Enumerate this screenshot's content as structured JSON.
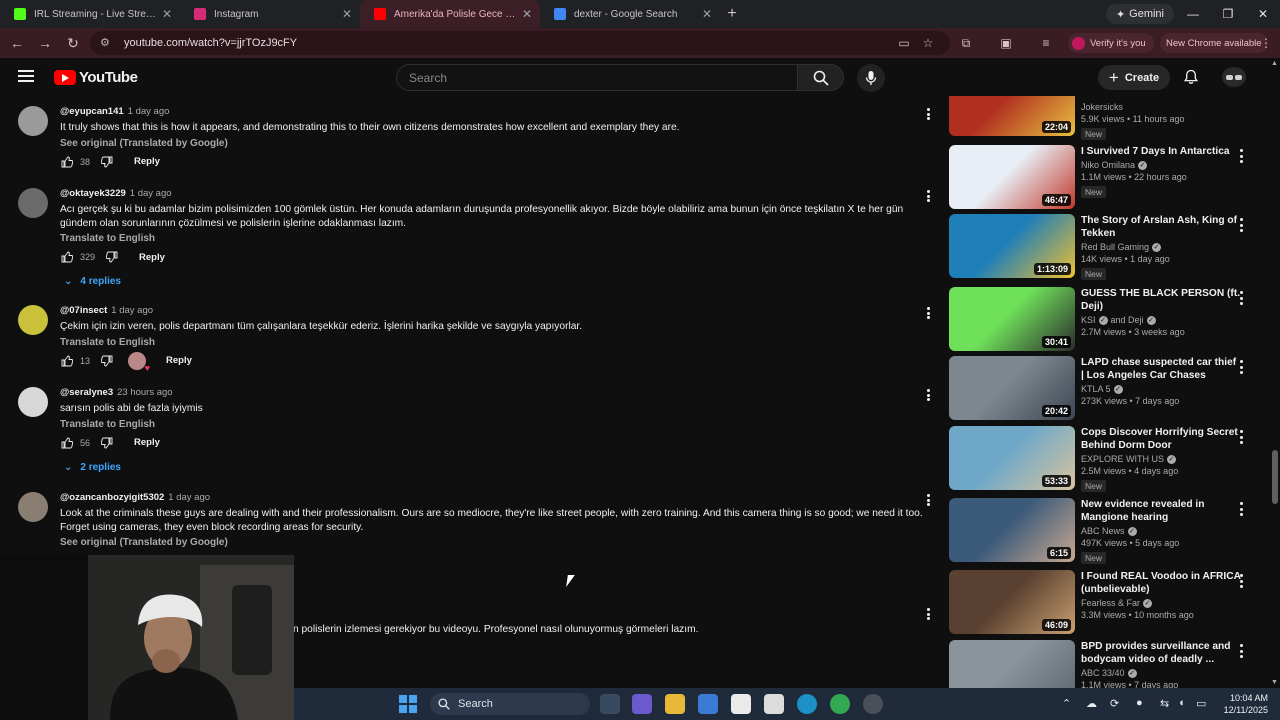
{
  "browser": {
    "tabs": [
      {
        "title": "IRL Streaming - Live Streams on",
        "favicon": "kick-logo-icon",
        "color": "#53fc18",
        "active": false
      },
      {
        "title": "Instagram",
        "favicon": "instagram-logo-icon",
        "color": "#d62976",
        "active": false
      },
      {
        "title": "Amerika'da Polisle Gece Devriye",
        "favicon": "youtube-logo-icon",
        "color": "#ff0000",
        "active": true
      },
      {
        "title": "dexter - Google Search",
        "favicon": "google-logo-icon",
        "color": "#4285f4",
        "active": false
      }
    ],
    "gemini_label": "Gemini",
    "url": "youtube.com/watch?v=jjrTOzJ9cFY",
    "verify_label": "Verify it's you",
    "update_label": "New Chrome available"
  },
  "youtube": {
    "logo_text": "YouTube",
    "search_placeholder": "Search",
    "create_label": "Create"
  },
  "comments": [
    {
      "handle": "@eyupcan141",
      "time": "1 day ago",
      "text": "It truly shows that this is how it appears, and demonstrating this to their own citizens demonstrates how excellent and exemplary they are.",
      "link": "See original (Translated by Google)",
      "likes": "38",
      "reply": "Reply",
      "replies": ""
    },
    {
      "handle": "@oktayek3229",
      "time": "1 day ago",
      "text": "Acı gerçek şu ki bu adamlar bizim polisimizden 100 gömlek üstün. Her konuda adamların duruşunda profesyonellik akıyor. Bizde böyle olabiliriz ama bunun için önce teşkilatın X te her gün gündem olan sorunlarının çözülmesi ve polislerin işlerine odaklanması lazım.",
      "link": "Translate to English",
      "likes": "329",
      "reply": "Reply",
      "replies": "4 replies"
    },
    {
      "handle": "@07insect",
      "time": "1 day ago",
      "text": "Çekim için izin veren, polis departmanı tüm çalışanlara teşekkür ederiz. İşlerini harika şekilde ve saygıyla yapıyorlar.",
      "link": "Translate to English",
      "likes": "13",
      "reply": "Reply",
      "replies": ""
    },
    {
      "handle": "@seralyne3",
      "time": "23 hours ago",
      "text": "sarısın polis abi de fazla iyiymis",
      "link": "Translate to English",
      "likes": "56",
      "reply": "Reply",
      "replies": "2 replies"
    },
    {
      "handle": "@ozancanbozyigit5302",
      "time": "1 day ago",
      "text": "Look at the criminals these guys are dealing with and their professionalism. Ours are so mediocre, they're like street people, with zero training. And this camera thing is so good; we need it too. Forget using cameras, they even block recording areas for security.",
      "link": "See original (Translated by Google)",
      "likes": "",
      "reply": "",
      "replies": ""
    },
    {
      "handle": "",
      "time": "",
      "text": "n polislerin izlemesi gerekiyor bu videoyu. Profesyonel nasıl olunuyormuş görmeleri lazım.",
      "link": "",
      "likes": "",
      "reply": "",
      "replies": ""
    }
  ],
  "sidebar": [
    {
      "title": "",
      "channel": "Jokersicks",
      "verified": false,
      "meta": "5.9K views • 11 hours ago",
      "badge": "New",
      "duration": "22:04",
      "thumb": [
        "#b03020",
        "#e8c040"
      ]
    },
    {
      "title": "I Survived 7 Days In Antarctica",
      "channel": "Niko Omilana",
      "verified": true,
      "meta": "1.1M views • 22 hours ago",
      "badge": "New",
      "duration": "46:47",
      "thumb": [
        "#e8eef5",
        "#c0392b"
      ]
    },
    {
      "title": "The Story of Arslan Ash, King of Tekken",
      "channel": "Red Bull Gaming",
      "verified": true,
      "meta": "14K views • 1 day ago",
      "badge": "New",
      "duration": "1:13:09",
      "thumb": [
        "#1f7fb8",
        "#f0c030"
      ]
    },
    {
      "title": "GUESS THE BLACK PERSON (ft. Deji)",
      "channel": "KSI",
      "verified": true,
      "channel2": "and Deji",
      "meta": "2.7M views • 3 weeks ago",
      "badge": "",
      "duration": "30:41",
      "thumb": [
        "#6fe05a",
        "#2b2b2b"
      ]
    },
    {
      "title": "LAPD chase suspected car thief | Los Angeles Car Chases",
      "channel": "KTLA 5",
      "verified": true,
      "meta": "273K views • 7 days ago",
      "badge": "",
      "duration": "20:42",
      "thumb": [
        "#7d8790",
        "#3b4650"
      ]
    },
    {
      "title": "Cops Discover Horrifying Secret Behind Dorm Door",
      "channel": "EXPLORE WITH US",
      "verified": true,
      "meta": "2.5M views • 4 days ago",
      "badge": "New",
      "duration": "53:33",
      "thumb": [
        "#6fa8c8",
        "#d9c4a0"
      ]
    },
    {
      "title": "New evidence revealed in Mangione hearing",
      "channel": "ABC News",
      "verified": true,
      "meta": "497K views • 5 days ago",
      "badge": "New",
      "duration": "6:15",
      "thumb": [
        "#3c5a7a",
        "#c8a890"
      ]
    },
    {
      "title": "I Found REAL Voodoo in AFRICA (unbelievable)",
      "channel": "Fearless & Far",
      "verified": true,
      "meta": "3.3M views • 10 months ago",
      "badge": "",
      "duration": "46:09",
      "thumb": [
        "#5a4030",
        "#c8a070"
      ]
    },
    {
      "title": "BPD provides surveillance and bodycam video of deadly ...",
      "channel": "ABC 33/40",
      "verified": true,
      "meta": "1.1M views • 7 days ago",
      "badge": "",
      "duration": "",
      "thumb": [
        "#8a949c",
        "#5c666e"
      ]
    }
  ],
  "taskbar": {
    "search_label": "Search",
    "time": "10:04 AM",
    "date": "12/11/2025"
  }
}
